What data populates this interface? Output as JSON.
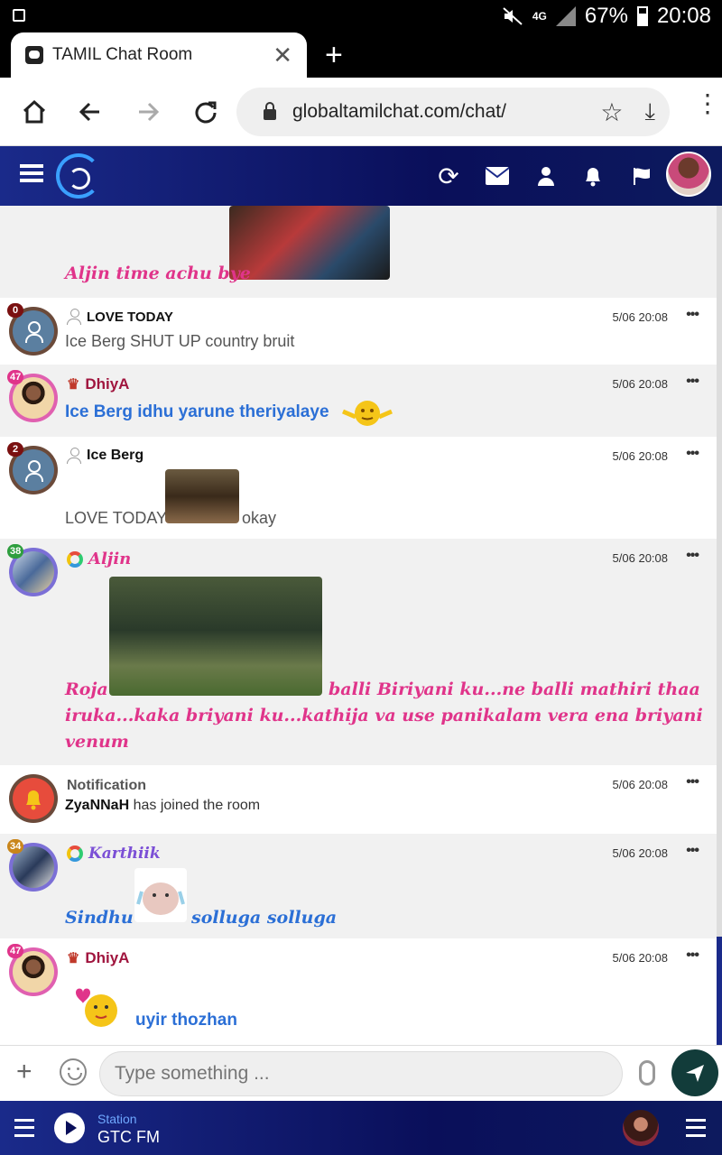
{
  "status_bar": {
    "battery": "67%",
    "time": "20:08",
    "network": "4G"
  },
  "browser": {
    "tab_title": "TAMIL Chat Room",
    "tab_close": "✕",
    "new_tab": "+",
    "url": "globaltamilchat.com/chat/"
  },
  "messages": [
    {
      "text": "Aljin time achu bye"
    },
    {
      "name": "LOVE TODAY",
      "name_color": "#111111",
      "badge": "0",
      "badge_color": "#7a1010",
      "ring_color": "#6b4a3a",
      "time": "5/06 20:08",
      "text": "Ice Berg SHUT UP country bruit"
    },
    {
      "name": "DhiyA",
      "name_color": "#a0153e",
      "badge": "47",
      "badge_color": "#e0348a",
      "ring_color": "#e060b0",
      "time": "5/06 20:08",
      "text": "Ice Berg idhu yarune theriyalaye"
    },
    {
      "name": "Ice Berg",
      "name_color": "#111111",
      "badge": "2",
      "badge_color": "#7a1010",
      "ring_color": "#6b4a3a",
      "time": "5/06 20:08",
      "text_before": "LOVE TODAY",
      "text_after": "okay"
    },
    {
      "name": "Aljin",
      "name_color": "#e0348a",
      "badge": "38",
      "badge_color": "#2e9e3e",
      "ring_color": "#7b6fd6",
      "time": "5/06 20:08",
      "text_before": "Roja",
      "text_after": "balli Biriyani ku...ne balli mathiri thaa",
      "text_line2": "iruka...kaka briyani ku...kathija va use panikalam vera ena briyani",
      "text_line3": "venum"
    },
    {
      "name": "Notification",
      "name_color": "#555555",
      "ring_color": "#6b4a3a",
      "time": "5/06 20:08",
      "bold_user": "ZyaNNaH",
      "text": "has joined the room"
    },
    {
      "name": "Karthiik",
      "name_color": "#7b4fd6",
      "badge": "34",
      "badge_color": "#c9851a",
      "ring_color": "#7b6fd6",
      "time": "5/06 20:08",
      "text_before": "Sindhu",
      "text_after": "solluga solluga"
    },
    {
      "name": "DhiyA",
      "name_color": "#a0153e",
      "badge": "47",
      "badge_color": "#e0348a",
      "ring_color": "#e060b0",
      "time": "5/06 20:08",
      "text": "uyir thozhan"
    }
  ],
  "composer": {
    "placeholder": "Type something ..."
  },
  "radio": {
    "station_label": "Station",
    "station_name": "GTC FM"
  },
  "icons": {
    "more": "•••"
  }
}
